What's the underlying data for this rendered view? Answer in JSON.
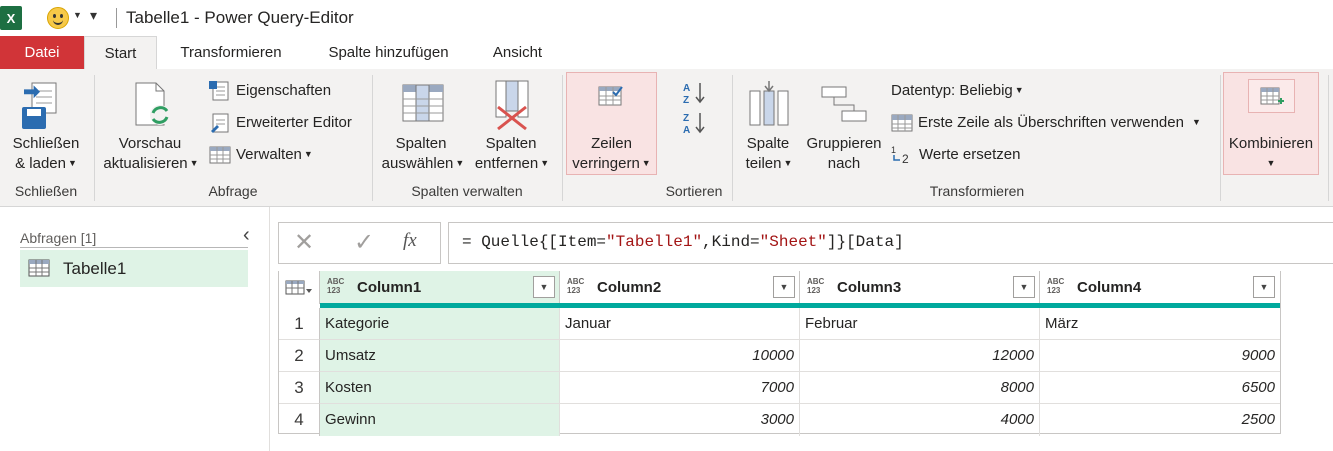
{
  "titlebar": {
    "app_icon": "X",
    "title": "Tabelle1 - Power Query-Editor"
  },
  "tabs": [
    "Datei",
    "Start",
    "Transformieren",
    "Spalte hinzufügen",
    "Ansicht"
  ],
  "ribbon": {
    "close_load": {
      "line1": "Schließen",
      "line2": "& laden"
    },
    "preview": {
      "line1": "Vorschau",
      "line2": "aktualisieren"
    },
    "properties": "Eigenschaften",
    "advanced_editor": "Erweiterter Editor",
    "manage": "Verwalten",
    "select_columns": {
      "line1": "Spalten",
      "line2": "auswählen"
    },
    "remove_columns": {
      "line1": "Spalten",
      "line2": "entfernen"
    },
    "reduce_rows": {
      "line1": "Zeilen",
      "line2": "verringern"
    },
    "split_column": {
      "line1": "Spalte",
      "line2": "teilen"
    },
    "group_by": {
      "line1": "Gruppieren",
      "line2": "nach"
    },
    "datatype": "Datentyp: Beliebig",
    "first_row_headers": "Erste Zeile als Überschriften verwenden",
    "replace_values": "Werte ersetzen",
    "combine": "Kombinieren",
    "groups": {
      "close": "Schließen",
      "query": "Abfrage",
      "manage_columns": "Spalten verwalten",
      "sort": "Sortieren",
      "transform": "Transformieren"
    }
  },
  "queries": {
    "header": "Abfragen [1]",
    "items": [
      "Tabelle1"
    ]
  },
  "formula": {
    "cancel": "✕",
    "commit": "✓",
    "fx": "fx",
    "text": "= Quelle{[Item=\"Tabelle1\",Kind=\"Sheet\"]}[Data]"
  },
  "grid": {
    "type_label_top": "ABC",
    "type_label_bottom": "123",
    "columns": [
      "Column1",
      "Column2",
      "Column3",
      "Column4"
    ],
    "rows": [
      {
        "n": "1",
        "c1": "Kategorie",
        "c2": "Januar",
        "c3": "Februar",
        "c4": "März"
      },
      {
        "n": "2",
        "c1": "Umsatz",
        "c2": "10000",
        "c3": "12000",
        "c4": "9000"
      },
      {
        "n": "3",
        "c1": "Kosten",
        "c2": "7000",
        "c3": "8000",
        "c4": "6500"
      },
      {
        "n": "4",
        "c1": "Gewinn",
        "c2": "3000",
        "c3": "4000",
        "c4": "2500"
      }
    ]
  },
  "colors": {
    "file_tab": "#d13438",
    "selected_query": "#dff3e6",
    "quality_bar": "#00a99d",
    "excel_green": "#1d6f42"
  }
}
